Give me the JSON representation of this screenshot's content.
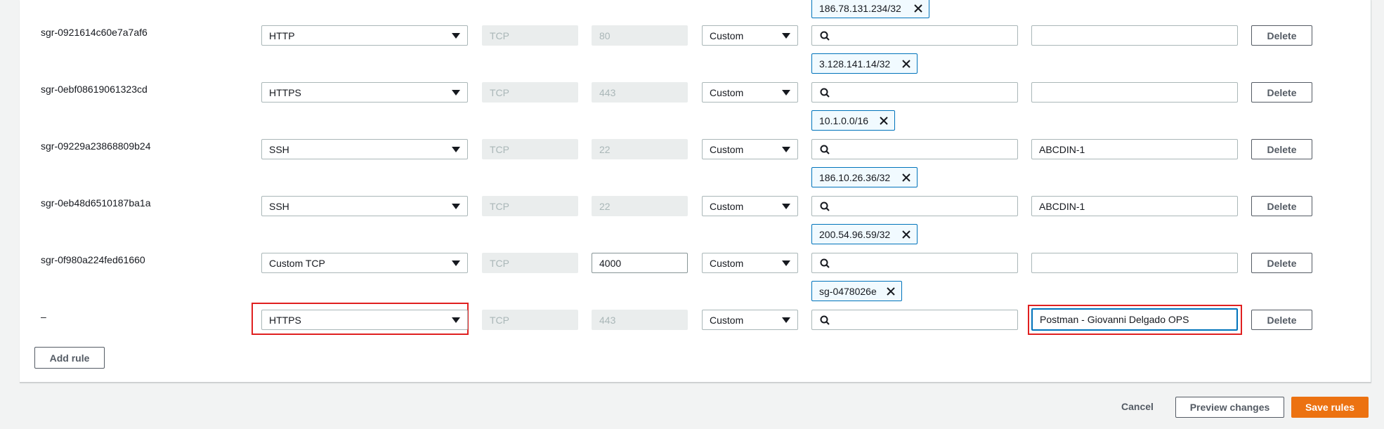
{
  "rules": [
    {
      "id": "sgr-0921614c60e7a7af6",
      "type": "HTTP",
      "protocol": "TCP",
      "port": "80",
      "source_type": "Custom",
      "source_token": "186.78.131.234/32",
      "description": "",
      "port_editable": false
    },
    {
      "id": "sgr-0ebf08619061323cd",
      "type": "HTTPS",
      "protocol": "TCP",
      "port": "443",
      "source_type": "Custom",
      "source_token": "3.128.141.14/32",
      "description": "",
      "port_editable": false
    },
    {
      "id": "sgr-09229a23868809b24",
      "type": "SSH",
      "protocol": "TCP",
      "port": "22",
      "source_type": "Custom",
      "source_token": "10.1.0.0/16",
      "description": "ABCDIN-1",
      "port_editable": false
    },
    {
      "id": "sgr-0eb48d6510187ba1a",
      "type": "SSH",
      "protocol": "TCP",
      "port": "22",
      "source_type": "Custom",
      "source_token": "186.10.26.36/32",
      "description": "ABCDIN-1",
      "port_editable": false
    },
    {
      "id": "sgr-0f980a224fed61660",
      "type": "Custom TCP",
      "protocol": "TCP",
      "port": "4000",
      "source_type": "Custom",
      "source_token": "200.54.96.59/32",
      "description": "",
      "port_editable": true
    },
    {
      "id": "–",
      "type": "HTTPS",
      "protocol": "TCP",
      "port": "443",
      "source_type": "Custom",
      "source_token": "sg-0478026e",
      "description": "Postman - Giovanni Delgado OPS",
      "port_editable": false
    }
  ],
  "labels": {
    "delete": "Delete",
    "add_rule": "Add rule",
    "cancel": "Cancel",
    "preview": "Preview changes",
    "save": "Save rules"
  },
  "colors": {
    "primary": "#ec7211",
    "token_border": "#0073bb",
    "highlight": "#e02020"
  }
}
